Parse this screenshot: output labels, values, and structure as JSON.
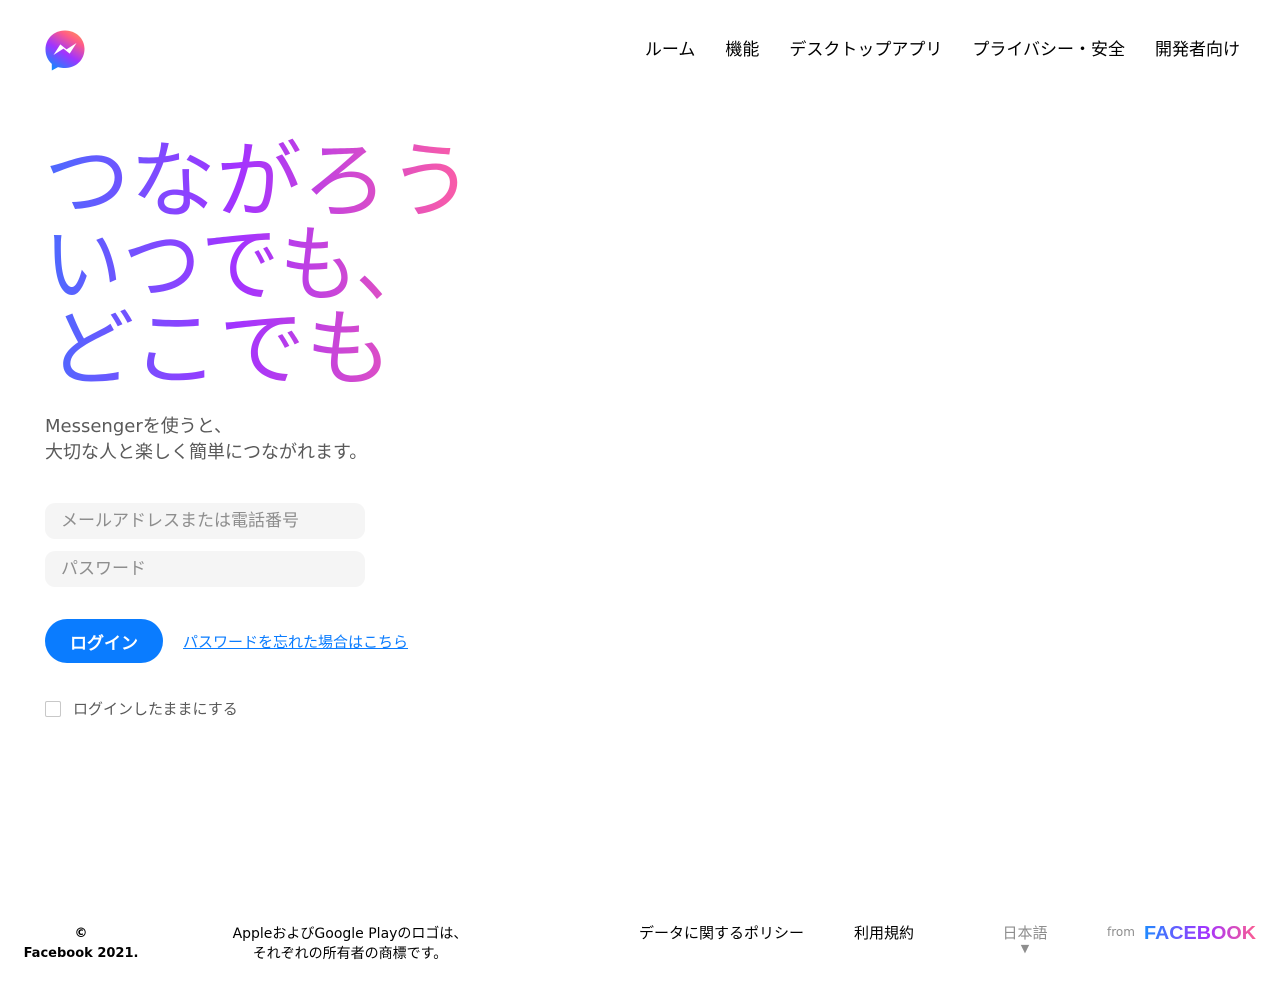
{
  "header": {
    "nav": [
      {
        "label": "ルーム"
      },
      {
        "label": "機能"
      },
      {
        "label": "デスクトップアプリ"
      },
      {
        "label": "プライバシー・安全"
      },
      {
        "label": "開発者向け"
      }
    ]
  },
  "hero": {
    "lines": [
      "つながろう",
      "いつでも、",
      "どこでも"
    ],
    "gradient_colors": [
      "#4b6bff",
      "#a333ff",
      "#ff5fa2"
    ]
  },
  "subtitle": {
    "line1": "Messengerを使うと、",
    "line2": "大切な人と楽しく簡単につながれます。"
  },
  "form": {
    "email_placeholder": "メールアドレスまたは電話番号",
    "password_placeholder": "パスワード",
    "login_label": "ログイン",
    "forgot_label": "パスワードを忘れた場合はこちら",
    "remember_label": "ログインしたままにする",
    "remember_checked": false
  },
  "footer": {
    "copyright_symbol": "©",
    "copyright_text": "Facebook 2021.",
    "trademark_line1": "AppleおよびGoogle Playのロゴは、",
    "trademark_line2": "それぞれの所有者の商標です。",
    "policy_label": "データに関するポリシー",
    "terms_label": "利用規約",
    "language": "日本語",
    "from_label": "from",
    "brand": "FACEBOOK"
  },
  "colors": {
    "accent": "#0a7cff",
    "input_bg": "#f5f5f5",
    "muted_text": "#8e8e8e"
  },
  "icons": {
    "logo": "messenger-logo-icon",
    "caret": "caret-down-icon"
  }
}
